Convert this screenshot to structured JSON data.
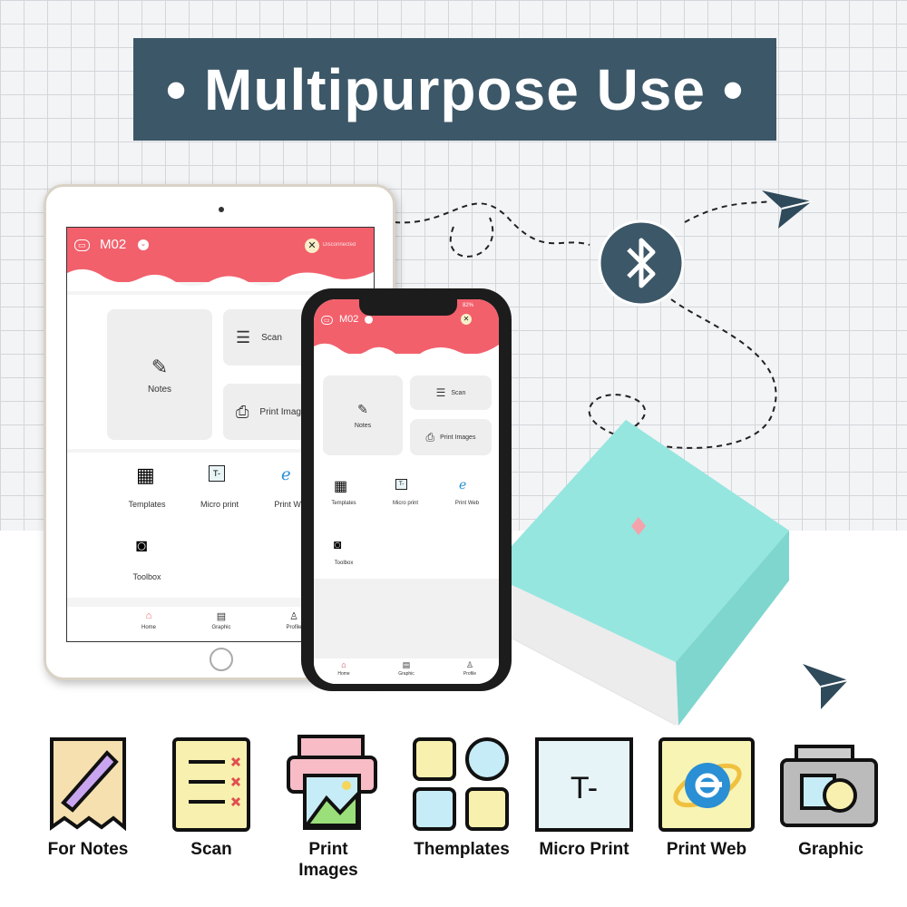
{
  "banner": {
    "title": "• Multipurpose Use •",
    "color": "#3c5768"
  },
  "tablet": {
    "device": "M02",
    "status": "Disconnected",
    "tiles": [
      "Notes",
      "Scan",
      "Print Images"
    ],
    "tools": [
      "Templates",
      "Micro print",
      "Print Web",
      "Toolbox"
    ],
    "nav": [
      "Home",
      "Graphic",
      "Profile"
    ]
  },
  "phone": {
    "device": "M02",
    "battery": "82%",
    "tiles": [
      "Notes",
      "Scan",
      "Print Images"
    ],
    "tools": [
      "Templates",
      "Micro print",
      "Print Web",
      "Toolbox"
    ],
    "nav": [
      "Home",
      "Graphic",
      "Profile"
    ]
  },
  "icons": {
    "bluetooth": "bluetooth-icon",
    "accent": "#f2606c",
    "printer_color": "#8fe3dc"
  },
  "features": [
    {
      "label": "For Notes",
      "icon": "notes-icon"
    },
    {
      "label": "Scan",
      "icon": "scan-icon"
    },
    {
      "label": "Print Images",
      "icon": "print-images-icon"
    },
    {
      "label": "Themplates",
      "icon": "templates-icon"
    },
    {
      "label": "Micro Print",
      "icon": "micro-print-icon"
    },
    {
      "label": "Print Web",
      "icon": "print-web-icon"
    },
    {
      "label": "Graphic",
      "icon": "graphic-icon"
    }
  ],
  "micro_glyph": "T-"
}
